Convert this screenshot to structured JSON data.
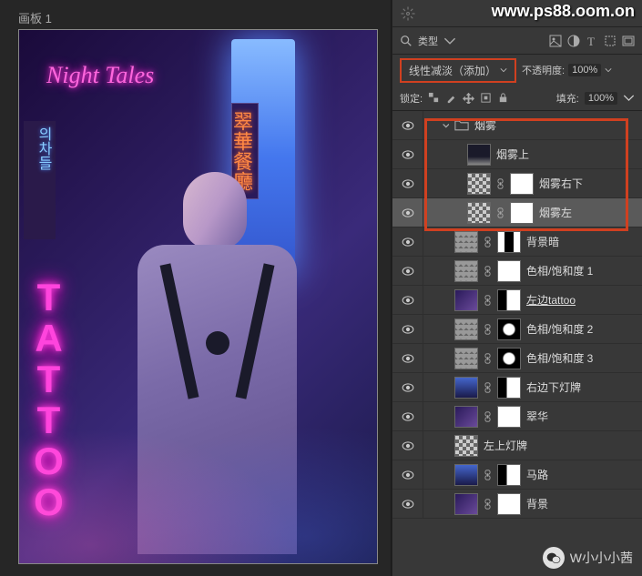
{
  "watermark_top": "www.ps88.oom.on",
  "watermark_bottom": "W小小小茜",
  "artboard_label": "画板 1",
  "canvas": {
    "tattoo_neon": "TATTOO",
    "night_neon": "Night Tales",
    "vert_sign": "翠華餐廳",
    "left_sign": "의차들"
  },
  "panel": {
    "type_label": "类型",
    "blend_mode": "线性减淡（添加）",
    "opacity_label": "不透明度:",
    "opacity_value": "100%",
    "lock_label": "锁定:",
    "fill_label": "填充:",
    "fill_value": "100%"
  },
  "layers": [
    {
      "name": "烟雾",
      "kind": "group",
      "indent": 1
    },
    {
      "name": "烟雾上",
      "kind": "layer",
      "indent": 3,
      "thumb": "smoke-thumb"
    },
    {
      "name": "烟雾右下",
      "kind": "masked",
      "indent": 3,
      "thumb": "checker",
      "mask": "mask"
    },
    {
      "name": "烟雾左",
      "kind": "masked",
      "indent": 3,
      "thumb": "checker",
      "mask": "mask",
      "selected": true
    },
    {
      "name": "背景暗",
      "kind": "masked",
      "indent": 2,
      "thumb": "adj",
      "mask": "mask-mid"
    },
    {
      "name": "色相/饱和度 1",
      "kind": "masked",
      "indent": 2,
      "thumb": "adj",
      "mask": "mask"
    },
    {
      "name": "左边tattoo",
      "kind": "masked",
      "indent": 2,
      "thumb": "img1",
      "mask": "mask-dark",
      "underline": true
    },
    {
      "name": "色相/饱和度 2",
      "kind": "masked",
      "indent": 2,
      "thumb": "adj",
      "mask": "mask-blob"
    },
    {
      "name": "色相/饱和度 3",
      "kind": "masked",
      "indent": 2,
      "thumb": "adj",
      "mask": "mask-blob"
    },
    {
      "name": "右边下灯牌",
      "kind": "masked",
      "indent": 2,
      "thumb": "img2",
      "mask": "mask-dark"
    },
    {
      "name": "翠华",
      "kind": "masked",
      "indent": 2,
      "thumb": "img1",
      "mask": "mask"
    },
    {
      "name": "左上灯牌",
      "kind": "layer",
      "indent": 2,
      "thumb": "checker"
    },
    {
      "name": "马路",
      "kind": "masked",
      "indent": 2,
      "thumb": "img2",
      "mask": "mask-dark"
    },
    {
      "name": "背景",
      "kind": "masked",
      "indent": 2,
      "thumb": "img1",
      "mask": "mask"
    }
  ]
}
